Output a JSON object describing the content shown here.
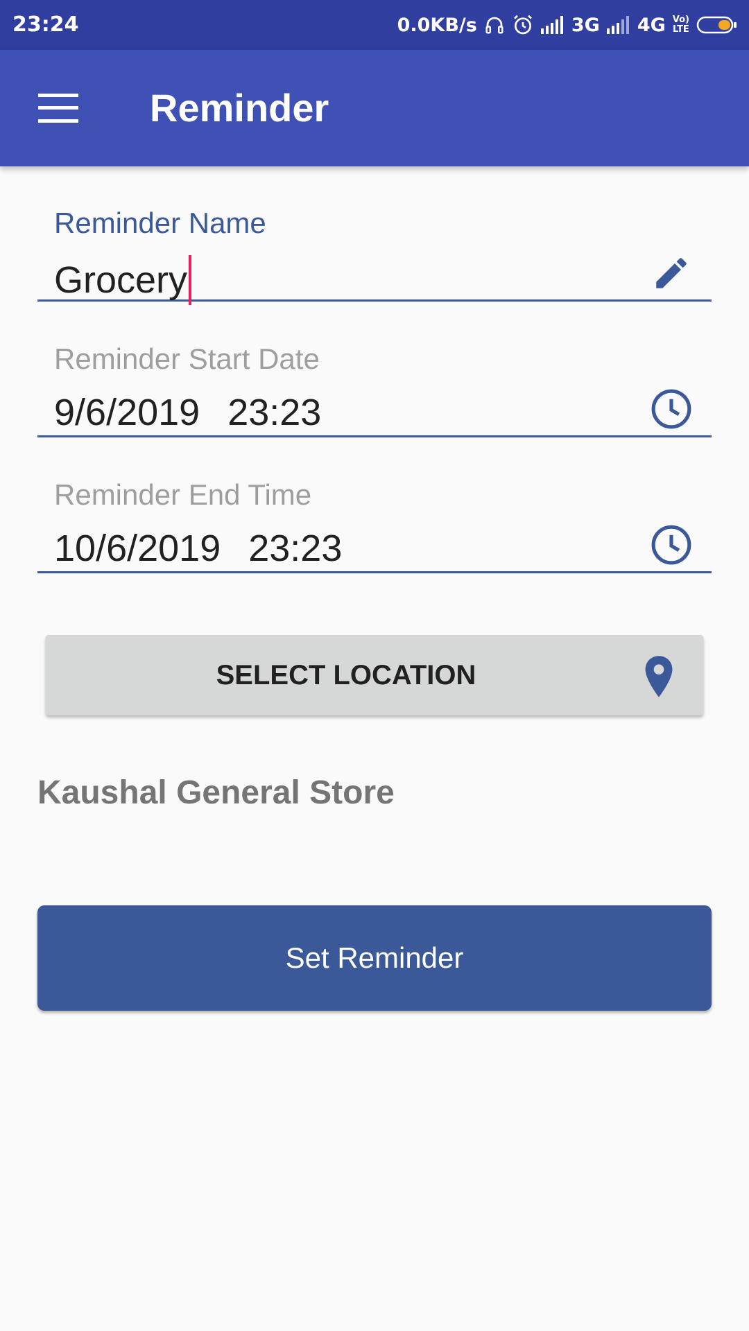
{
  "status_bar": {
    "time": "23:24",
    "network_speed": "0.0KB/s",
    "network_3g": "3G",
    "network_4g": "4G",
    "volte_line1": "Vo)",
    "volte_line2": "LTE",
    "icons": [
      "headphones-icon",
      "alarm-icon",
      "signal-icon",
      "battery-icon"
    ],
    "battery_level": 0.35,
    "battery_color": "#f5a623"
  },
  "app_bar": {
    "title": "Reminder",
    "menu_icon": "hamburger-menu-icon",
    "color": "#3f51b5"
  },
  "form": {
    "name": {
      "label": "Reminder Name",
      "value": "Grocery",
      "icon": "pencil-icon"
    },
    "start": {
      "label": "Reminder Start Date",
      "date": "9/6/2019",
      "time": "23:23",
      "icon": "clock-icon"
    },
    "end": {
      "label": "Reminder End Time",
      "date": "10/6/2019",
      "time": "23:23",
      "icon": "clock-icon"
    }
  },
  "location": {
    "button_label": "SELECT LOCATION",
    "icon": "map-pin-icon",
    "selected": "Kaushal General Store"
  },
  "submit": {
    "label": "Set Reminder",
    "color": "#3b5998"
  },
  "colors": {
    "accent": "#3b5998",
    "cursor": "#e91e63",
    "status_bar": "#303f9f"
  }
}
